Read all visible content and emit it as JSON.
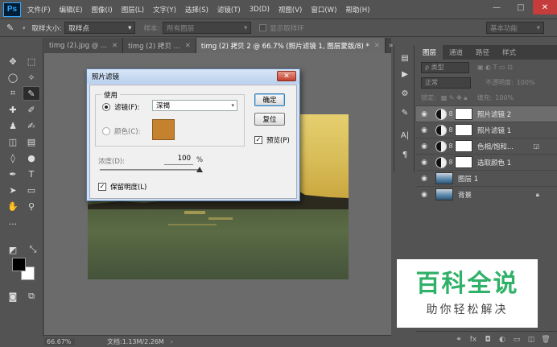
{
  "app": {
    "logo": "Ps",
    "menu": [
      "文件(F)",
      "编辑(E)",
      "图像(I)",
      "图层(L)",
      "文字(Y)",
      "选择(S)",
      "滤镜(T)",
      "3D(D)",
      "视图(V)",
      "窗口(W)",
      "帮助(H)"
    ],
    "window_controls": {
      "minimize": "—",
      "restore": "□",
      "close": "✕"
    }
  },
  "options_bar": {
    "sample_size_label": "取样大小:",
    "sample_size_value": "取样点",
    "sample_label": "样本:",
    "sample_value": "所有图层",
    "show_ring_label": "显示取样环",
    "workspace": "基本功能"
  },
  "tabs": [
    {
      "label": "timg (2).jpg @ ..."
    },
    {
      "label": "timg (2) 拷贝 ..."
    },
    {
      "label": "timg (2) 拷贝 2 @ 66.7% (照片滤镜 1, 图层蒙版/8) *"
    }
  ],
  "tabs_more": "»",
  "status": {
    "zoom": "66.67%",
    "doc": "文档:1.13M/2.26M",
    "arrow": "›"
  },
  "dialog": {
    "title": "照片滤镜",
    "close": "✕",
    "group_label": "使用",
    "filter_label": "滤镜(F):",
    "filter_value": "深褐",
    "color_label": "颜色(C):",
    "color_swatch": "#c5822e",
    "ok": "确定",
    "reset": "复位",
    "preview_label": "预览(P)",
    "preview_checked": true,
    "density_label": "浓度(D):",
    "density_value": "100",
    "density_unit": "%",
    "density_fraction": 1.0,
    "preserve_label": "保留明度(L)",
    "preserve_checked": true
  },
  "layers_panel": {
    "tabs": [
      "图层",
      "通道",
      "路径",
      "样式"
    ],
    "filter_kind": "ρ 类型",
    "blend_mode": "正常",
    "opacity_label": "不透明度:",
    "opacity_value": "100%",
    "lock_label": "锁定:",
    "fill_label": "填充:",
    "fill_value": "100%",
    "layers": [
      {
        "name": "照片滤镜 2",
        "type": "adjustment",
        "selected": true
      },
      {
        "name": "照片滤镜 1",
        "type": "adjustment",
        "selected": false
      },
      {
        "name": "色相/饱和...",
        "type": "adjustment",
        "selected": false
      },
      {
        "name": "选取颜色 1",
        "type": "adjustment",
        "selected": false
      },
      {
        "name": "图层 1",
        "type": "image",
        "selected": false
      },
      {
        "name": "背景",
        "type": "image",
        "selected": false
      }
    ]
  },
  "watermark": {
    "title": "百科全说",
    "subtitle": "助你轻松解决"
  }
}
